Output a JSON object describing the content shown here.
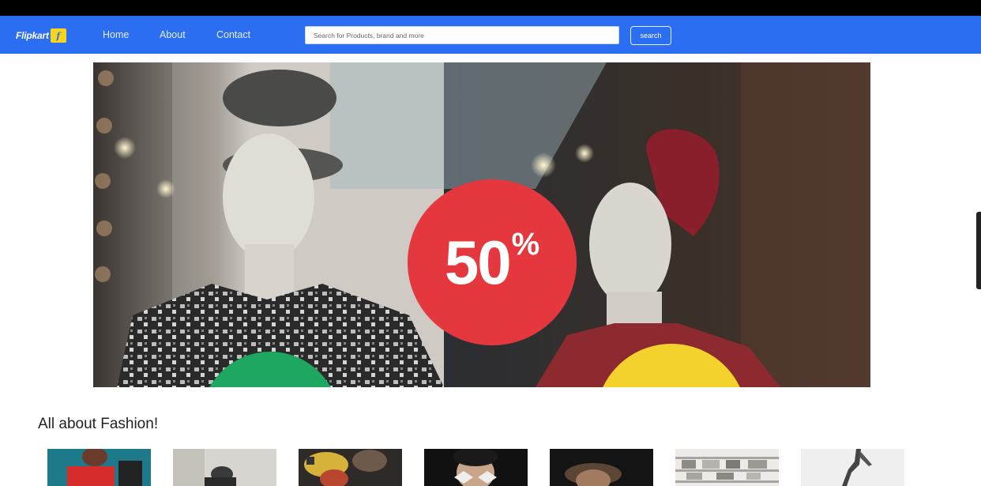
{
  "navbar": {
    "logo_text": "Flipkart",
    "logo_mark": "f",
    "links": [
      "Home",
      "About",
      "Contact"
    ],
    "search_placeholder": "Search for Products, brand and more",
    "search_button": "search",
    "background": "#2b6ef2"
  },
  "hero": {
    "badge_number": "50",
    "badge_symbol": "%",
    "badge_color": "#e5383e",
    "circle_colors": [
      "#1ea760",
      "#f4d22d"
    ]
  },
  "section": {
    "title": "All about Fashion!"
  },
  "thumbnails": [
    "fashion-photo-1",
    "fashion-photo-2",
    "fashion-photo-3",
    "fashion-photo-4",
    "fashion-photo-5",
    "fashion-photo-6",
    "fashion-photo-7"
  ]
}
